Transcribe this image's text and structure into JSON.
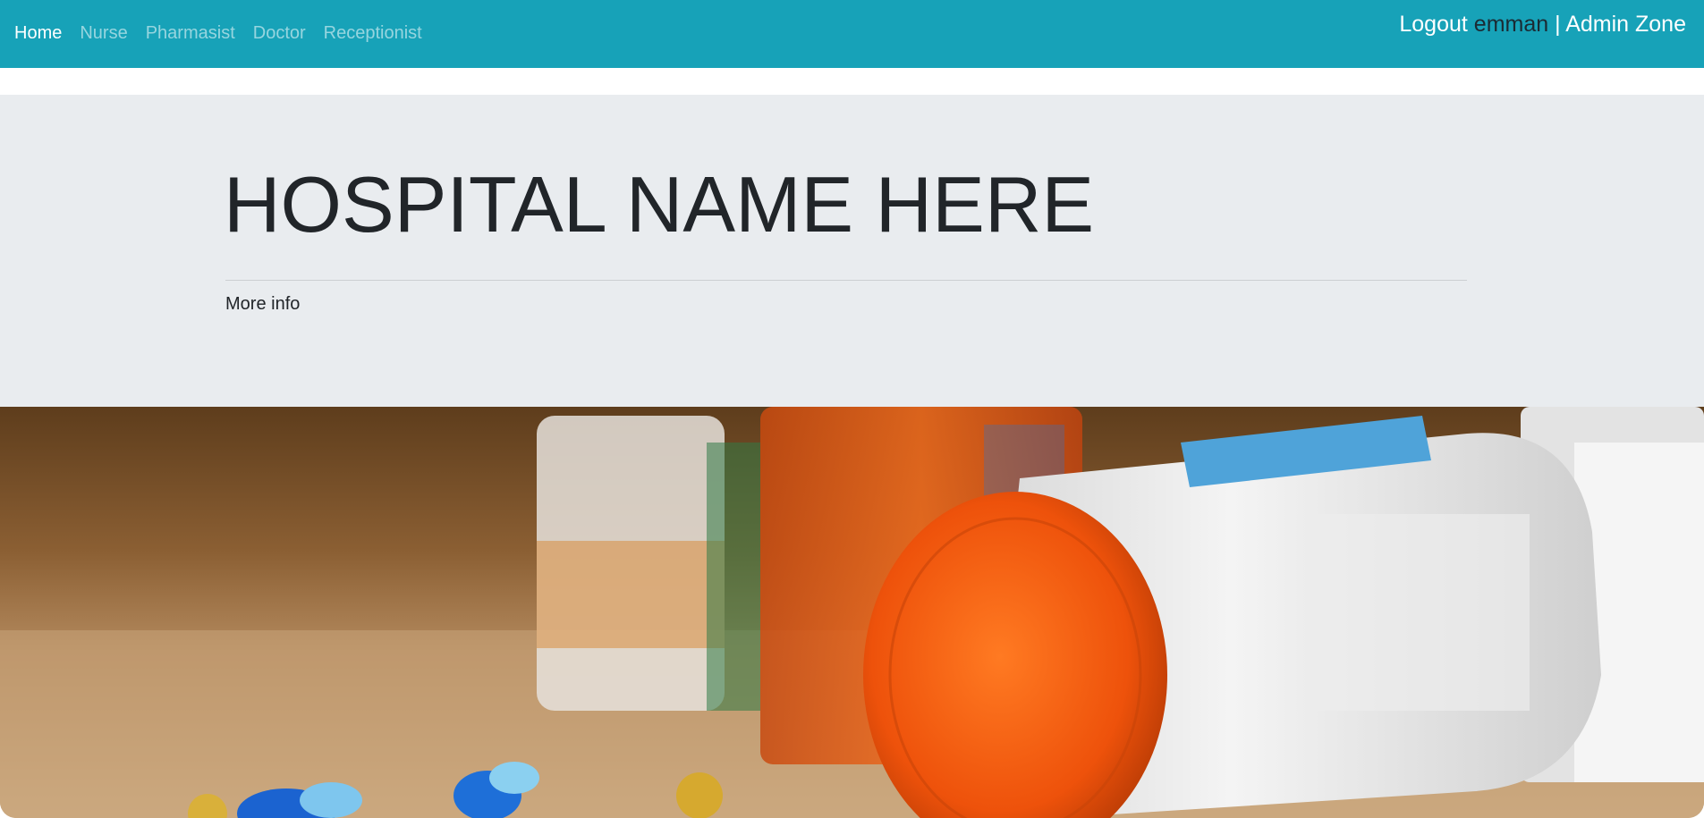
{
  "nav": {
    "links": [
      "Home",
      "Nurse",
      "Pharmasist",
      "Doctor",
      "Receptionist"
    ],
    "active": "Home",
    "logout_label": "Logout",
    "username": "emman",
    "separator": "|",
    "admin_label": "Admin Zone"
  },
  "hero": {
    "title": "HOSPITAL NAME HERE",
    "more_info": "More info"
  },
  "colors": {
    "navbar": "#17a2b8",
    "jumbotron": "#e9ecef",
    "cap_orange": "#f25a0c"
  },
  "image": {
    "subject": "medicine-bottles-and-capsules-photo"
  }
}
